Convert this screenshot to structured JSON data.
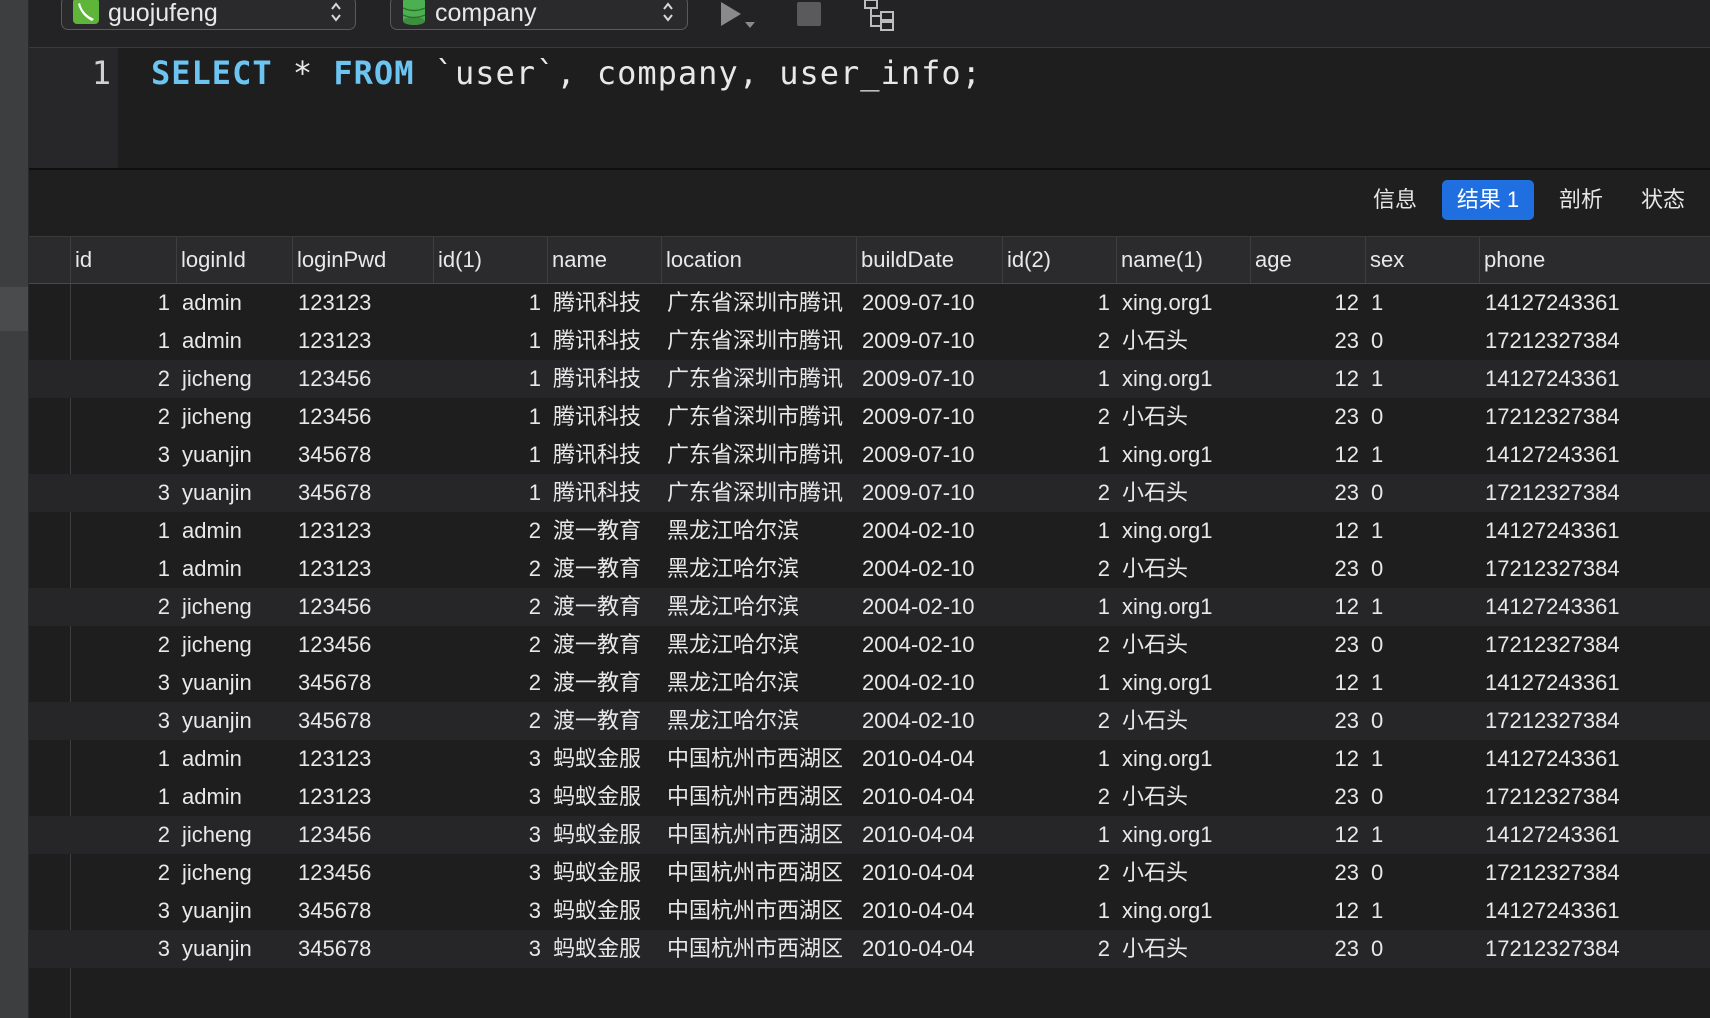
{
  "toolbar": {
    "connection": "guojufeng",
    "database": "company"
  },
  "editor": {
    "line_number": "1",
    "code": {
      "kw1": "SELECT",
      "star": " * ",
      "kw2": "FROM",
      "rest": " `user`, company, user_info;"
    }
  },
  "result_tabs": [
    {
      "label": "信息",
      "active": false
    },
    {
      "label": "结果 1",
      "active": true
    },
    {
      "label": "剖析",
      "active": false
    },
    {
      "label": "状态",
      "active": false
    }
  ],
  "colors": {
    "accent": "#1f6fe0",
    "keyword": "#6cc4f0"
  },
  "table": {
    "columns": [
      "id",
      "loginId",
      "loginPwd",
      "id(1)",
      "name",
      "location",
      "buildDate",
      "id(2)",
      "name(1)",
      "age",
      "sex",
      "phone"
    ],
    "rows": [
      [
        "1",
        "admin",
        "123123",
        "1",
        "腾讯科技",
        "广东省深圳市腾讯",
        "2009-07-10",
        "1",
        "xing.org1",
        "12",
        "1",
        "14127243361"
      ],
      [
        "1",
        "admin",
        "123123",
        "1",
        "腾讯科技",
        "广东省深圳市腾讯",
        "2009-07-10",
        "2",
        "小石头",
        "23",
        "0",
        "17212327384"
      ],
      [
        "2",
        "jicheng",
        "123456",
        "1",
        "腾讯科技",
        "广东省深圳市腾讯",
        "2009-07-10",
        "1",
        "xing.org1",
        "12",
        "1",
        "14127243361"
      ],
      [
        "2",
        "jicheng",
        "123456",
        "1",
        "腾讯科技",
        "广东省深圳市腾讯",
        "2009-07-10",
        "2",
        "小石头",
        "23",
        "0",
        "17212327384"
      ],
      [
        "3",
        "yuanjin",
        "345678",
        "1",
        "腾讯科技",
        "广东省深圳市腾讯",
        "2009-07-10",
        "1",
        "xing.org1",
        "12",
        "1",
        "14127243361"
      ],
      [
        "3",
        "yuanjin",
        "345678",
        "1",
        "腾讯科技",
        "广东省深圳市腾讯",
        "2009-07-10",
        "2",
        "小石头",
        "23",
        "0",
        "17212327384"
      ],
      [
        "1",
        "admin",
        "123123",
        "2",
        "渡一教育",
        "黑龙江哈尔滨",
        "2004-02-10",
        "1",
        "xing.org1",
        "12",
        "1",
        "14127243361"
      ],
      [
        "1",
        "admin",
        "123123",
        "2",
        "渡一教育",
        "黑龙江哈尔滨",
        "2004-02-10",
        "2",
        "小石头",
        "23",
        "0",
        "17212327384"
      ],
      [
        "2",
        "jicheng",
        "123456",
        "2",
        "渡一教育",
        "黑龙江哈尔滨",
        "2004-02-10",
        "1",
        "xing.org1",
        "12",
        "1",
        "14127243361"
      ],
      [
        "2",
        "jicheng",
        "123456",
        "2",
        "渡一教育",
        "黑龙江哈尔滨",
        "2004-02-10",
        "2",
        "小石头",
        "23",
        "0",
        "17212327384"
      ],
      [
        "3",
        "yuanjin",
        "345678",
        "2",
        "渡一教育",
        "黑龙江哈尔滨",
        "2004-02-10",
        "1",
        "xing.org1",
        "12",
        "1",
        "14127243361"
      ],
      [
        "3",
        "yuanjin",
        "345678",
        "2",
        "渡一教育",
        "黑龙江哈尔滨",
        "2004-02-10",
        "2",
        "小石头",
        "23",
        "0",
        "17212327384"
      ],
      [
        "1",
        "admin",
        "123123",
        "3",
        "蚂蚁金服",
        "中国杭州市西湖区",
        "2010-04-04",
        "1",
        "xing.org1",
        "12",
        "1",
        "14127243361"
      ],
      [
        "1",
        "admin",
        "123123",
        "3",
        "蚂蚁金服",
        "中国杭州市西湖区",
        "2010-04-04",
        "2",
        "小石头",
        "23",
        "0",
        "17212327384"
      ],
      [
        "2",
        "jicheng",
        "123456",
        "3",
        "蚂蚁金服",
        "中国杭州市西湖区",
        "2010-04-04",
        "1",
        "xing.org1",
        "12",
        "1",
        "14127243361"
      ],
      [
        "2",
        "jicheng",
        "123456",
        "3",
        "蚂蚁金服",
        "中国杭州市西湖区",
        "2010-04-04",
        "2",
        "小石头",
        "23",
        "0",
        "17212327384"
      ],
      [
        "3",
        "yuanjin",
        "345678",
        "3",
        "蚂蚁金服",
        "中国杭州市西湖区",
        "2010-04-04",
        "1",
        "xing.org1",
        "12",
        "1",
        "14127243361"
      ],
      [
        "3",
        "yuanjin",
        "345678",
        "3",
        "蚂蚁金服",
        "中国杭州市西湖区",
        "2010-04-04",
        "2",
        "小石头",
        "23",
        "0",
        "17212327384"
      ]
    ]
  }
}
